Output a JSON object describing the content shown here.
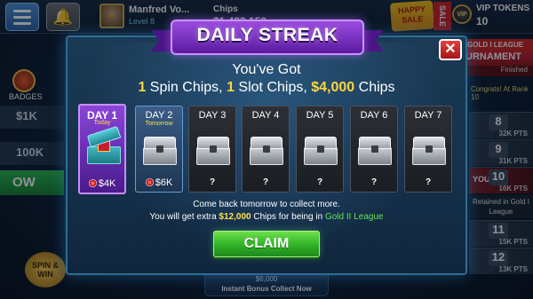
{
  "topbar": {
    "player_name": "Manfred Vo...",
    "player_level": "Level 8",
    "chips_label": "Chips",
    "chips_value": "$1,482,150",
    "happy_sale": "HAPPY SALE",
    "sale_tag": "SALE",
    "vip_badge": "VIP",
    "vip_label": "VIP TOKENS",
    "vip_count": "10"
  },
  "left_panel": {
    "badges_label": "BADGES",
    "amount_1": "$1K",
    "amount_2": "100K",
    "now_label": "OW",
    "spin_win": "SPIN & WIN"
  },
  "right_panel": {
    "league_head": "GOLD I LEAGUE",
    "tournament_title": "URNAMENT",
    "tournament_status": "Finished",
    "congrats": "Congrats! At Rank 10",
    "rows": [
      {
        "rank": "8",
        "pts": "32K PTS"
      },
      {
        "rank": "9",
        "pts": "31K PTS"
      },
      {
        "rank": "10",
        "pts": "16K PTS",
        "you": "YOU"
      },
      {
        "rank": "11",
        "pts": "15K PTS"
      },
      {
        "rank": "12",
        "pts": "13K PTS"
      }
    ],
    "retained": "Retained in Gold I League"
  },
  "bottom_bonus": {
    "amount": "$6,000",
    "label": "Instant Bonus",
    "action": "Collect Now"
  },
  "dialog": {
    "title": "DAILY STREAK",
    "subtitle": "You've Got",
    "reward": {
      "spin_count": "1",
      "spin_text": " Spin Chips, ",
      "slot_count": "1",
      "slot_text": " Slot Chips, ",
      "chips_amount": "$4,000",
      "chips_text": " Chips"
    },
    "close": "✕",
    "days": [
      {
        "label": "DAY 1",
        "sub": "Today",
        "reward": "$4K"
      },
      {
        "label": "DAY 2",
        "sub": "Tomorrow",
        "reward": "$6K"
      },
      {
        "label": "DAY 3",
        "reward": "?"
      },
      {
        "label": "DAY 4",
        "reward": "?"
      },
      {
        "label": "DAY 5",
        "reward": "?"
      },
      {
        "label": "DAY 6",
        "reward": "?"
      },
      {
        "label": "DAY 7",
        "reward": "?"
      }
    ],
    "info_line_1": "Come back tomorrow to collect more.",
    "info_line_2_pre": "You will get extra ",
    "info_line_2_amount": "$12,000",
    "info_line_2_mid": " Chips for being in ",
    "info_line_2_league": "Gold II League",
    "claim_label": "CLAIM"
  },
  "colors": {
    "accent_gold": "#ffd63a",
    "league_green": "#63e35a",
    "claim_green": "#33b52a",
    "ribbon_purple": "#7a36c8",
    "close_red": "#c82a2a"
  }
}
